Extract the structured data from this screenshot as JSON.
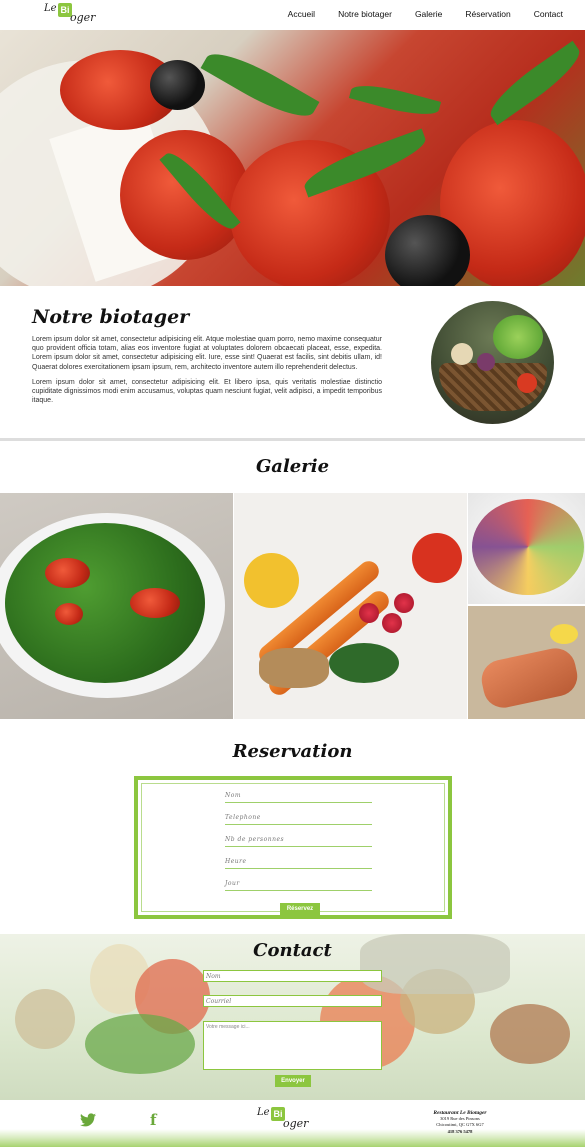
{
  "nav": {
    "logo": {
      "le": "Le",
      "leaf": "Bi",
      "tail": "oger"
    },
    "items": [
      "Accueil",
      "Notre biotager",
      "Galerie",
      "Réservation",
      "Contact"
    ]
  },
  "about": {
    "title": "Notre biotager",
    "p1": "Lorem ipsum dolor sit amet, consectetur adipisicing elit. Atque molestiae quam porro, nemo maxime consequatur quo provident officia totam, alias eos inventore fugiat at voluptates dolorem obcaecati placeat, esse, expedita. Lorem ipsum dolor sit amet, consectetur adipisicing elit. Iure, esse sint! Quaerat est facilis, sint debitis ullam, id! Quaerat dolores exercitationem ipsam ipsum, rem, architecto inventore autem illo reprehenderit delectus.",
    "p2": "Lorem ipsum dolor sit amet, consectetur adipisicing elit. Et libero ipsa, quis veritatis molestiae distinctio cupiditate dignissimos modi enim accusamus, voluptas quam nesciunt fugiat, velit adipisci, a impedit temporibus itaque."
  },
  "gallery": {
    "title": "Galerie"
  },
  "reservation": {
    "title": "Reservation",
    "fields": [
      "Nom",
      "Telephone",
      "Nb de personnes",
      "Heure",
      "Jour"
    ],
    "button": "Réservez"
  },
  "contact": {
    "title": "Contact",
    "name_placeholder": "Nom",
    "email_placeholder": "Courriel",
    "message_placeholder": "Votre message ici...",
    "button": "Envoyer"
  },
  "footer": {
    "logo": {
      "le": "Le",
      "leaf": "Bi",
      "tail": "oger"
    },
    "restaurant": "Restaurant Le Biotager",
    "street": "3019 Rue des Pinsons",
    "city": "Chicoutimi, QC G7X 6G7",
    "phone": "418 376 5478"
  },
  "colors": {
    "accent": "#8cc63f",
    "text": "#111111"
  },
  "icons": [
    "twitter-icon",
    "facebook-icon"
  ]
}
